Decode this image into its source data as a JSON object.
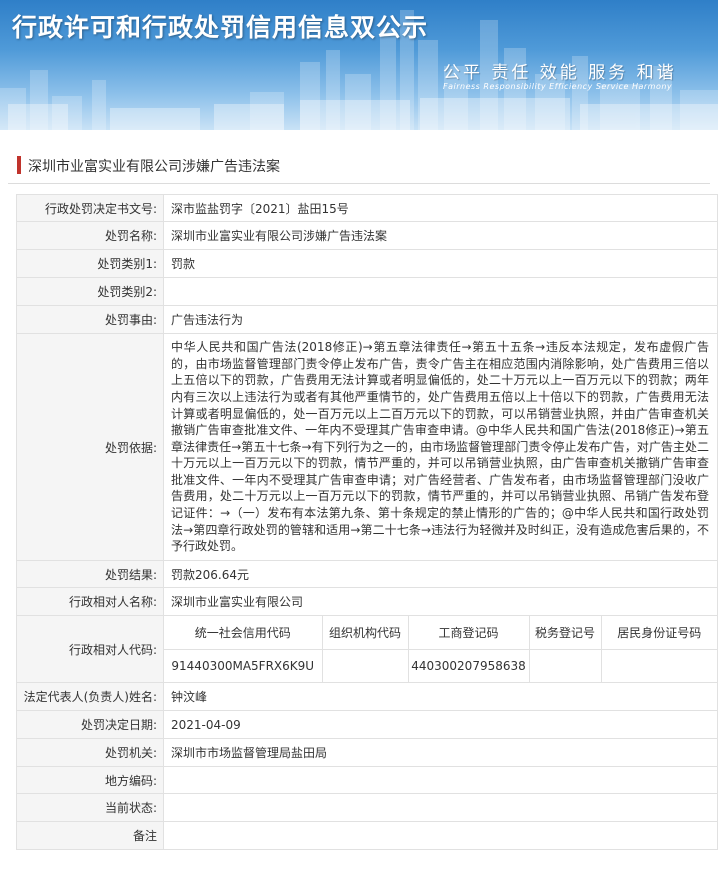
{
  "header": {
    "title": "行政许可和行政处罚信用信息双公示",
    "slogan": "公平 责任 效能 服务 和谐",
    "slogan_en": "Fairness Responsibility Efficiency Service Harmony"
  },
  "case": {
    "title": "深圳市业富实业有限公司涉嫌广告违法案"
  },
  "fields": {
    "doc_number": {
      "label": "行政处罚决定书文号:",
      "value": "深市监盐罚字〔2021〕盐田15号"
    },
    "penalty_name": {
      "label": "处罚名称:",
      "value": "深圳市业富实业有限公司涉嫌广告违法案"
    },
    "category1": {
      "label": "处罚类别1:",
      "value": "罚款"
    },
    "category2": {
      "label": "处罚类别2:",
      "value": ""
    },
    "reason": {
      "label": "处罚事由:",
      "value": "广告违法行为"
    },
    "basis": {
      "label": "处罚依据:",
      "value": "中华人民共和国广告法(2018修正)→第五章法律责任→第五十五条→违反本法规定，发布虚假广告的，由市场监督管理部门责令停止发布广告，责令广告主在相应范围内消除影响，处广告费用三倍以上五倍以下的罚款，广告费用无法计算或者明显偏低的，处二十万元以上一百万元以下的罚款；两年内有三次以上违法行为或者有其他严重情节的，处广告费用五倍以上十倍以下的罚款，广告费用无法计算或者明显偏低的，处一百万元以上二百万元以下的罚款，可以吊销营业执照，并由广告审查机关撤销广告审查批准文件、一年内不受理其广告审查申请。@中华人民共和国广告法(2018修正)→第五章法律责任→第五十七条→有下列行为之一的，由市场监督管理部门责令停止发布广告，对广告主处二十万元以上一百万元以下的罚款，情节严重的，并可以吊销营业执照，由广告审查机关撤销广告审查批准文件、一年内不受理其广告审查申请；对广告经营者、广告发布者，由市场监督管理部门没收广告费用，处二十万元以上一百万元以下的罚款，情节严重的，并可以吊销营业执照、吊销广告发布登记证件：→（一）发布有本法第九条、第十条规定的禁止情形的广告的；@中华人民共和国行政处罚法→第四章行政处罚的管辖和适用→第二十七条→违法行为轻微并及时纠正，没有造成危害后果的，不予行政处罚。"
    },
    "result": {
      "label": "处罚结果:",
      "value": "罚款206.64元"
    },
    "party_name": {
      "label": "行政相对人名称:",
      "value": "深圳市业富实业有限公司"
    },
    "party_code": {
      "label": "行政相对人代码:"
    },
    "legal_rep": {
      "label": "法定代表人(负责人)姓名:",
      "value": "钟汶峰"
    },
    "decision_date": {
      "label": "处罚决定日期:",
      "value": "2021-04-09"
    },
    "authority": {
      "label": "处罚机关:",
      "value": "深圳市市场监督管理局盐田局"
    },
    "region_code": {
      "label": "地方编码:",
      "value": ""
    },
    "status": {
      "label": "当前状态:",
      "value": ""
    },
    "remark": {
      "label": "备注",
      "value": ""
    }
  },
  "codes": {
    "headers": [
      "统一社会信用代码",
      "组织机构代码",
      "工商登记码",
      "税务登记号",
      "居民身份证号码"
    ],
    "values": [
      "91440300MA5FRX6K9U",
      "",
      "440300207958638",
      "",
      ""
    ]
  },
  "colors": {
    "accent_bar": "#c0332c",
    "label_bg": "#f5f5f5",
    "border": "#e1e1e1",
    "banner_top": "#2f7fc8"
  }
}
